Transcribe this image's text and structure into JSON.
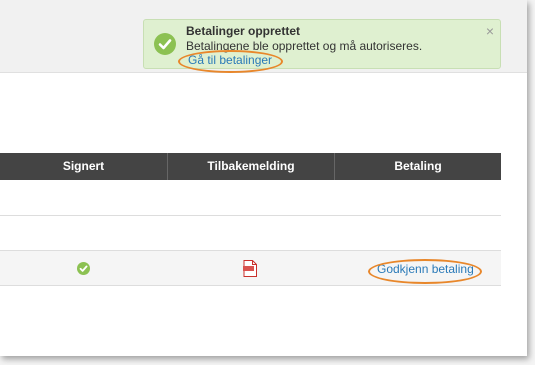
{
  "notification": {
    "title": "Betalinger opprettet",
    "message": "Betalingene ble opprettet og må autoriseres.",
    "link_label": "Gå til betalinger",
    "close_symbol": "×",
    "status_icon": "check-circle-icon",
    "background_color": "#dff0d0",
    "accent_color": "#8cc152"
  },
  "table": {
    "headers": [
      "Signert",
      "Tilbakemelding",
      "Betaling"
    ],
    "header_color": "#444444",
    "rows": [
      {
        "signed_icon": "check-circle-icon",
        "feedback_icon": "pdf-file-icon",
        "payment_action": "Godkjenn betaling"
      }
    ]
  },
  "annotation": {
    "highlight_color": "#e8872b"
  },
  "link_color": "#2a7ab8"
}
